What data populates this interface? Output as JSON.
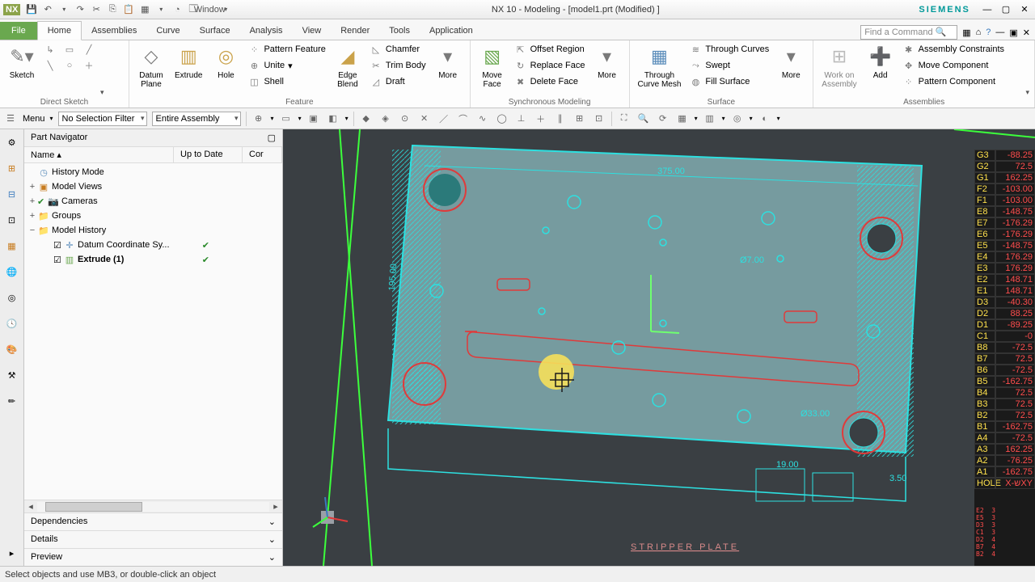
{
  "app": {
    "logo": "NX",
    "title": "NX 10 - Modeling - [model1.prt (Modified) ]",
    "brand": "SIEMENS",
    "window_menu": "Window"
  },
  "menu": {
    "file": "File",
    "tabs": [
      "Home",
      "Assemblies",
      "Curve",
      "Surface",
      "Analysis",
      "View",
      "Render",
      "Tools",
      "Application"
    ],
    "active": 0,
    "find_placeholder": "Find a Command"
  },
  "ribbon": {
    "groups": {
      "direct_sketch": {
        "label": "Direct Sketch",
        "sketch": "Sketch"
      },
      "feature": {
        "label": "Feature",
        "datum_plane": "Datum\nPlane",
        "extrude": "Extrude",
        "hole": "Hole",
        "pattern": "Pattern Feature",
        "unite": "Unite",
        "shell": "Shell",
        "edge_blend": "Edge\nBlend",
        "chamfer": "Chamfer",
        "trim_body": "Trim Body",
        "draft": "Draft",
        "more": "More"
      },
      "sync": {
        "label": "Synchronous Modeling",
        "move_face": "Move\nFace",
        "offset_region": "Offset Region",
        "replace_face": "Replace Face",
        "delete_face": "Delete Face",
        "more": "More"
      },
      "surface": {
        "label": "Surface",
        "through_curve_mesh": "Through\nCurve Mesh",
        "through_curves": "Through Curves",
        "swept": "Swept",
        "fill_surface": "Fill Surface",
        "more": "More"
      },
      "assemblies": {
        "label": "Assemblies",
        "work_on": "Work on\nAssembly",
        "add": "Add",
        "constraints": "Assembly Constraints",
        "move_comp": "Move Component",
        "pattern_comp": "Pattern Component"
      }
    }
  },
  "selbar": {
    "menu": "Menu",
    "filter": "No Selection Filter",
    "scope": "Entire Assembly"
  },
  "nav": {
    "title": "Part Navigator",
    "cols": {
      "name": "Name",
      "uptodate": "Up to Date",
      "cor": "Cor"
    },
    "items": {
      "history_mode": "History Mode",
      "model_views": "Model Views",
      "cameras": "Cameras",
      "groups": "Groups",
      "model_history": "Model History",
      "datum_csys": "Datum Coordinate Sy...",
      "extrude": "Extrude (1)"
    },
    "footer": {
      "dependencies": "Dependencies",
      "details": "Details",
      "preview": "Preview"
    }
  },
  "view": {
    "dim_w": "375.00",
    "dim_h": "195.00",
    "dim_off": "19.00",
    "dim_t": "3.50",
    "dia1": "Ø7.00",
    "dia2": "Ø33.00",
    "label": "STRIPPER PLATE"
  },
  "table": {
    "rows": [
      [
        "G3",
        "-88.25"
      ],
      [
        "G2",
        "72.5"
      ],
      [
        "G1",
        "162.25"
      ],
      [
        "F2",
        "-103.00"
      ],
      [
        "F1",
        "-103.00"
      ],
      [
        "E8",
        "-148.75"
      ],
      [
        "E7",
        "-176.29"
      ],
      [
        "E6",
        "-176.29"
      ],
      [
        "E5",
        "-148.75"
      ],
      [
        "E4",
        "176.29"
      ],
      [
        "E3",
        "176.29"
      ],
      [
        "E2",
        "148.71"
      ],
      [
        "E1",
        "148.71"
      ],
      [
        "D3",
        "-40.30"
      ],
      [
        "D2",
        "88.25"
      ],
      [
        "D1",
        "-89.25"
      ],
      [
        "C1",
        "-0"
      ],
      [
        "B8",
        "-72.5"
      ],
      [
        "B7",
        "72.5"
      ],
      [
        "B6",
        "-72.5"
      ],
      [
        "B5",
        "-162.75"
      ],
      [
        "B4",
        "72.5"
      ],
      [
        "B3",
        "72.5"
      ],
      [
        "B2",
        "72.5"
      ],
      [
        "B1",
        "-162.75"
      ],
      [
        "A4",
        "-72.5"
      ],
      [
        "A3",
        "162.25"
      ],
      [
        "A2",
        "-76.25"
      ],
      [
        "A1",
        "-162.75"
      ],
      [
        "HOLE",
        "X-שXY"
      ]
    ]
  },
  "status": {
    "msg": "Select objects and use MB3, or double-click an object"
  }
}
